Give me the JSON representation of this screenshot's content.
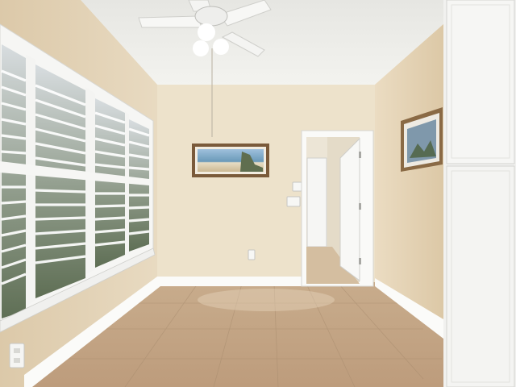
{
  "scene": {
    "subject": "empty-room",
    "elements": [
      "ceiling-fan",
      "plantation-shutters",
      "framed-beach-picture",
      "framed-wall-art",
      "open-doorway",
      "white-cabinet",
      "tile-floor"
    ]
  },
  "colors": {
    "wall_back": "#ede2cc",
    "wall_left": "#e4d4b8",
    "wall_right": "#e8d8bb",
    "ceiling": "#eeeeea",
    "floor": "#c8a988",
    "trim": "#ffffff",
    "cabinet": "#f2f2f0"
  }
}
